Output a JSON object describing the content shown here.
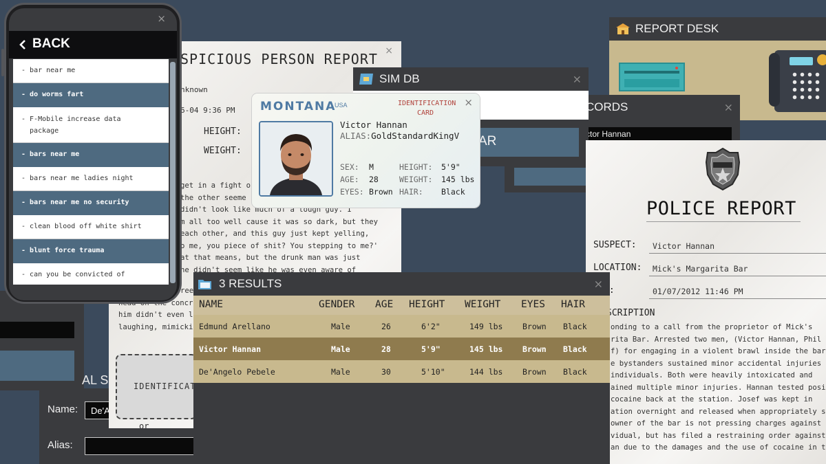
{
  "bg_color": "#3b4a5c",
  "phone": {
    "back_label": "BACK",
    "close": "×",
    "items": [
      {
        "text": "bar near me",
        "style": "white"
      },
      {
        "text": "do worms fart",
        "style": "dark"
      },
      {
        "text": "F-Mobile increase data package",
        "style": "white"
      },
      {
        "text": "bars near me",
        "style": "dark"
      },
      {
        "text": "bars near me ladies night",
        "style": "white"
      },
      {
        "text": "bars near me no security",
        "style": "dark"
      },
      {
        "text": "clean blood off white shirt",
        "style": "white"
      },
      {
        "text": "blunt force trauma",
        "style": "dark"
      },
      {
        "text": "can you be convicted of",
        "style": "white"
      }
    ]
  },
  "susp_report": {
    "title": "SPICIOUS PERSON REPORT",
    "close": "×",
    "line1": "nknown",
    "line2": "6-04 9:36 PM",
    "height_label": "HEIGHT:",
    "weight_label": "WEIGHT:",
    "narrative": [
      "get in a fight o",
      "the other seeme",
      " didn't look like much of a tough guy. I",
      "m all too well cause it was so dark, but they",
      " each other, and this guy just kept yelling,",
      "o me, you piece of shit? You stepping to me?'",
      "at that means, but the drunk man was just",
      "   he didn't seem like he was even aware of",
      "reel",
      "head on the concr",
      "him didn't even l",
      "laughing, mimicki"
    ],
    "id_placeholder": "IDENTIFICATI",
    "or_text": "or"
  },
  "sim_db": {
    "title": "SIM DB",
    "close": "×",
    "button_text": "AR"
  },
  "records": {
    "title": "CORDS",
    "close": "×",
    "field_value": "ctor Hannan"
  },
  "report_desk": {
    "title": "REPORT DESK"
  },
  "id_card": {
    "state": "MONTANA",
    "country": "USA",
    "card_title": "IDENTIFICATION CARD",
    "close": "×",
    "name": "Victor Hannan",
    "alias_label": "ALIAS:",
    "alias": "GoldStandardKingV",
    "sex_label": "SEX:",
    "sex": "M",
    "height_label": "HEIGHT:",
    "height": "5'9\"",
    "age_label": "AGE:",
    "age": "28",
    "weight_label": "WEIGHT:",
    "weight": "145 lbs",
    "eyes_label": "EYES:",
    "eyes": "Brown",
    "hair_label": "HAIR:",
    "hair": "Black"
  },
  "police_report": {
    "title": "POLICE REPORT",
    "suspect_label": "SUSPECT:",
    "suspect": "Victor Hannan",
    "location_label": "LOCATION:",
    "location": "Mick's Margarita Bar",
    "date_label": "E:",
    "date": "01/07/2012 11:46 PM",
    "desc_label": "SCRIPTION",
    "desc": [
      "onding to a call from the proprietor of Mick's",
      "rita Bar. Arrested two men, (Victor Hannan, Phil",
      "f) for engaging in a violent brawl inside the bar.",
      "e bystanders sustained minor accidental injuries from",
      " individuals. Both were heavily intoxicated and",
      "ained multiple minor injuries. Hannan tested positive",
      "cocaine back at the station. Josef was kept in",
      "ation overnight and released when appropriately sober.",
      "owner of the bar is not pressing charges against either",
      "vidual, but has filed a restraining order against",
      "an due to the damages and the use of cocaine in the"
    ]
  },
  "results": {
    "title": "3 RESULTS",
    "close": "×",
    "headers": [
      "NAME",
      "GENDER",
      "AGE",
      "HEIGHT",
      "WEIGHT",
      "EYES",
      "HAIR"
    ],
    "rows": [
      {
        "name": "Edmund Arellano",
        "gender": "Male",
        "age": "26",
        "height": "6'2\"",
        "weight": "149 lbs",
        "eyes": "Brown",
        "hair": "Black",
        "selected": false
      },
      {
        "name": "Victor Hannan",
        "gender": "Male",
        "age": "28",
        "height": "5'9\"",
        "weight": "145 lbs",
        "eyes": "Brown",
        "hair": "Black",
        "selected": true
      },
      {
        "name": "De'Angelo Pebele",
        "gender": "Male",
        "age": "30",
        "height": "5'10\"",
        "weight": "144 lbs",
        "eyes": "Brown",
        "hair": "Black",
        "selected": false
      }
    ]
  },
  "lower_left": {
    "partial_title": "AL S",
    "name_label": "Name:",
    "name_value": "De'A",
    "alias_label": "Alias:"
  }
}
